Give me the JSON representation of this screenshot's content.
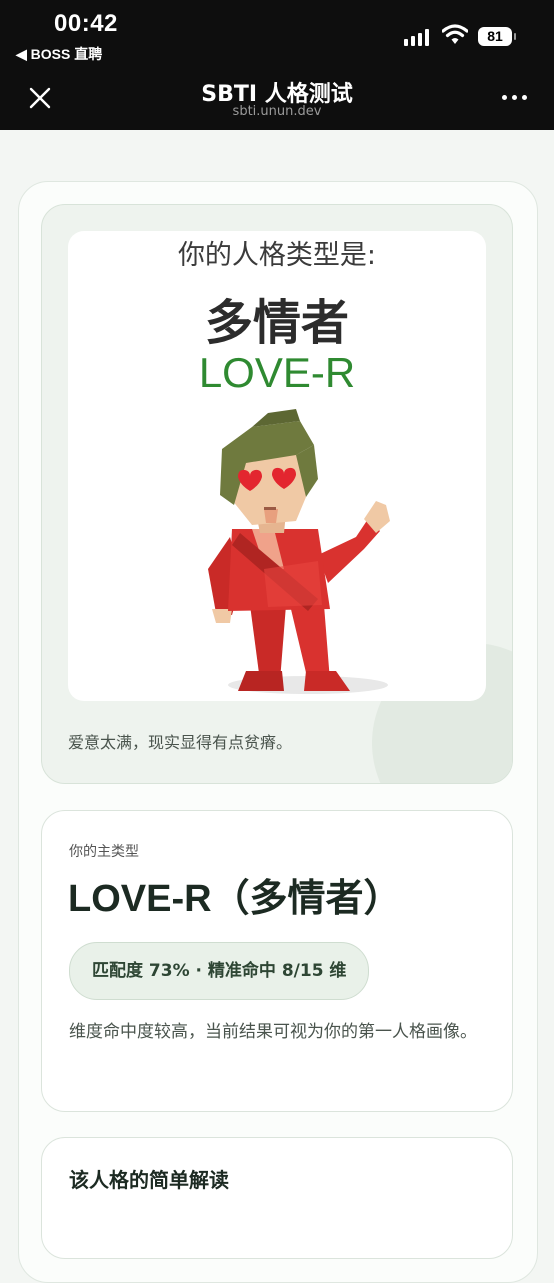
{
  "status_bar": {
    "time": "00:42",
    "back_app": "◀ BOSS 直聘",
    "battery": "81"
  },
  "nav": {
    "title": "SBTI 人格测试",
    "url": "sbti.unun.dev"
  },
  "result_poster": {
    "label": "你的人格类型是:",
    "type_cn": "多情者",
    "type_code": "LOVE-R",
    "tagline": "爱意太满，现实显得有点贫瘠。"
  },
  "main_type_card": {
    "label": "你的主类型",
    "title": "LOVE-R（多情者）",
    "match": "匹配度 73% · 精准命中 8/15 维",
    "description": "维度命中度较高，当前结果可视为你的第一人格画像。"
  },
  "interpretation_card": {
    "title": "该人格的简单解读"
  },
  "colors": {
    "accent_green": "#2f8a31",
    "figure_red": "#d9322f",
    "hair_olive": "#6f7a3e"
  }
}
